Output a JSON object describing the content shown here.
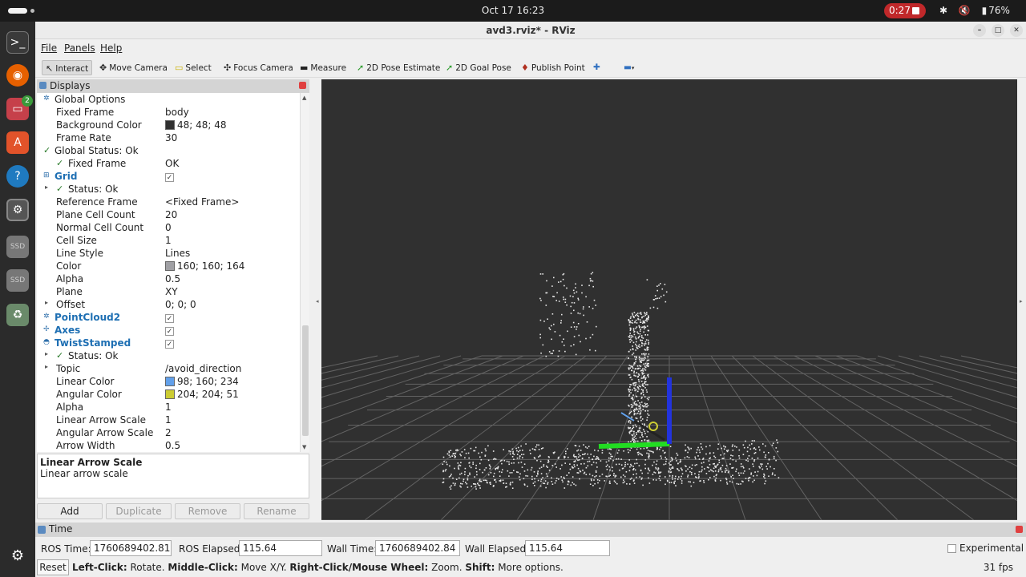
{
  "system": {
    "clock": "Oct 17  16:23",
    "recording": "0:27",
    "battery": "76%"
  },
  "dock": [
    "terminal-icon",
    "firefox-icon",
    "files-icon",
    "app-center-icon",
    "help-icon",
    "settings-icon",
    "ssd-icon",
    "ssd-icon",
    "trash-icon",
    "apps-grid-icon"
  ],
  "dock_badge": "2",
  "window": {
    "title": "avd3.rviz* - RViz"
  },
  "menu": {
    "file": "File",
    "panels": "Panels",
    "help": "Help"
  },
  "toolbar": {
    "interact": "Interact",
    "move_camera": "Move Camera",
    "select": "Select",
    "focus_camera": "Focus Camera",
    "measure": "Measure",
    "pose_estimate": "2D Pose Estimate",
    "goal_pose": "2D Goal Pose",
    "publish_point": "Publish Point"
  },
  "displays": {
    "title": "Displays",
    "rows": [
      {
        "key": "Global Options",
        "value": "",
        "indent": 1,
        "type": "header"
      },
      {
        "key": "Fixed Frame",
        "value": "body",
        "indent": 2
      },
      {
        "key": "Background Color",
        "value": "48; 48; 48",
        "indent": 2,
        "swatch": "#303030"
      },
      {
        "key": "Frame Rate",
        "value": "30",
        "indent": 2
      },
      {
        "key": "Global Status: Ok",
        "value": "",
        "indent": 1,
        "check": true
      },
      {
        "key": "Fixed Frame",
        "value": "OK",
        "indent": 2,
        "check": true
      },
      {
        "key": "Grid",
        "value": "",
        "indent": 1,
        "highlight": true,
        "checkbox": true
      },
      {
        "key": "Status: Ok",
        "value": "",
        "indent": 2,
        "check": true,
        "expand": true
      },
      {
        "key": "Reference Frame",
        "value": "<Fixed Frame>",
        "indent": 2
      },
      {
        "key": "Plane Cell Count",
        "value": "20",
        "indent": 2
      },
      {
        "key": "Normal Cell Count",
        "value": "0",
        "indent": 2
      },
      {
        "key": "Cell Size",
        "value": "1",
        "indent": 2
      },
      {
        "key": "Line Style",
        "value": "Lines",
        "indent": 2
      },
      {
        "key": "Color",
        "value": "160; 160; 164",
        "indent": 2,
        "swatch": "#a0a0a4"
      },
      {
        "key": "Alpha",
        "value": "0.5",
        "indent": 2
      },
      {
        "key": "Plane",
        "value": "XY",
        "indent": 2
      },
      {
        "key": "Offset",
        "value": "0; 0; 0",
        "indent": 2,
        "expand": true
      },
      {
        "key": "PointCloud2",
        "value": "",
        "indent": 1,
        "highlight": true,
        "checkbox": true
      },
      {
        "key": "Axes",
        "value": "",
        "indent": 1,
        "highlight": true,
        "checkbox": true
      },
      {
        "key": "TwistStamped",
        "value": "",
        "indent": 1,
        "highlight": true,
        "checkbox": true
      },
      {
        "key": "Status: Ok",
        "value": "",
        "indent": 2,
        "check": true,
        "expand": true
      },
      {
        "key": "Topic",
        "value": "/avoid_direction",
        "indent": 2,
        "expand": true
      },
      {
        "key": "Linear Color",
        "value": "98; 160; 234",
        "indent": 2,
        "swatch": "#62a0ea"
      },
      {
        "key": "Angular Color",
        "value": "204; 204; 51",
        "indent": 2,
        "swatch": "#cccc33"
      },
      {
        "key": "Alpha",
        "value": "1",
        "indent": 2
      },
      {
        "key": "Linear Arrow Scale",
        "value": "1",
        "indent": 2
      },
      {
        "key": "Angular Arrow Scale",
        "value": "2",
        "indent": 2
      },
      {
        "key": "Arrow Width",
        "value": "0.5",
        "indent": 2
      }
    ],
    "description_title": "Linear Arrow Scale",
    "description_text": "Linear arrow scale",
    "buttons": {
      "add": "Add",
      "duplicate": "Duplicate",
      "remove": "Remove",
      "rename": "Rename"
    }
  },
  "time": {
    "title": "Time",
    "ros_time_label": "ROS Time:",
    "ros_time": "1760689402.81",
    "ros_elapsed_label": "ROS Elapsed:",
    "ros_elapsed": "115.64",
    "wall_time_label": "Wall Time:",
    "wall_time": "1760689402.84",
    "wall_elapsed_label": "Wall Elapsed:",
    "wall_elapsed": "115.64",
    "experimental": "Experimental"
  },
  "status": {
    "reset": "Reset",
    "hint_left_click": "Left-Click:",
    "hint_left_text": " Rotate. ",
    "hint_middle_click": "Middle-Click:",
    "hint_middle_text": " Move X/Y. ",
    "hint_right_click": "Right-Click/Mouse Wheel:",
    "hint_right_text": " Zoom. ",
    "hint_shift": "Shift:",
    "hint_shift_text": " More options.",
    "fps": "31 fps"
  }
}
